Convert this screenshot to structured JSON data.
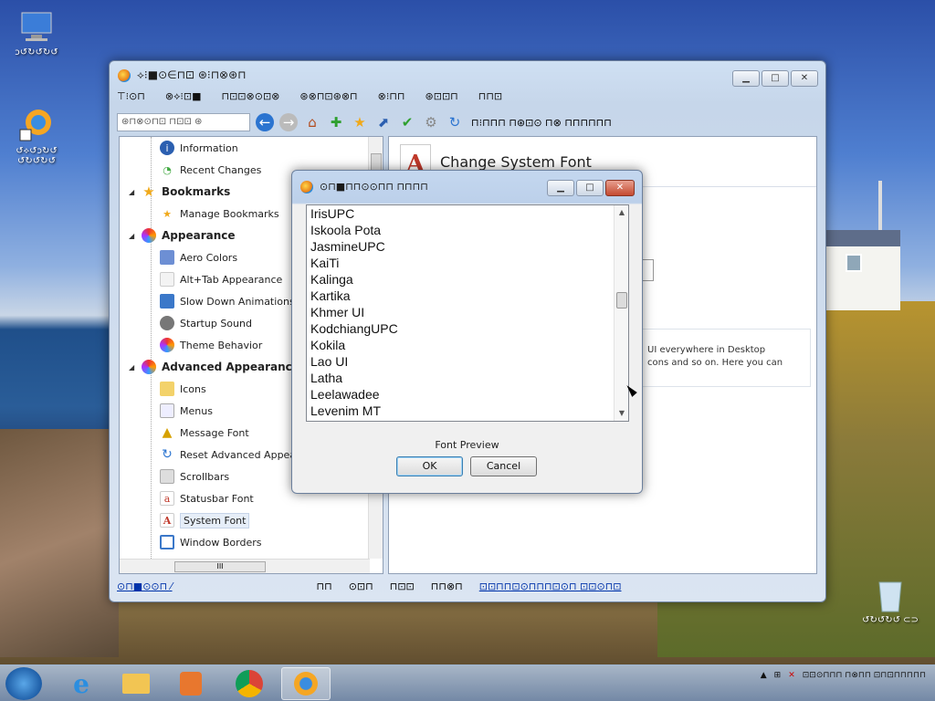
{
  "desktop": {
    "icons": [
      {
        "label": "ↄ↺↻↺↻↺"
      },
      {
        "label": "↺⟡↺ↄ↻↺ ↺↻↺↻↺"
      },
      {
        "label": "↺↻↺↻↺ ⊂⊃"
      }
    ]
  },
  "main_window": {
    "title": "⟡⁝■⊙∈⊓⊡ ⊛⁝⊓⊗⊛⊓",
    "menu": [
      "⊤⁝⊙⊓",
      "⊗⟡⁝⊡■",
      "⊓⊡⊡⊗⊙⊡⊗",
      "⊛⊗⊓⊡⊛⊗⊓",
      "⊗⁝⊓⊓",
      "⊛⊡⊡⊓",
      "⊓⊓⊡"
    ],
    "search_placeholder": "⊛⊓⊗⊙⊓⊡ ⊓⊡⊡ ⊛",
    "toolbar_label_1": "⊓⁝⊓⊓⊓ ⊓⊛⊡⊙ ⊓⊗ ⊓⊓⊓⊓⊓⊓",
    "tree": {
      "items": [
        {
          "label": "Information",
          "type": "item"
        },
        {
          "label": "Recent Changes",
          "type": "item"
        },
        {
          "label": "Bookmarks",
          "type": "group"
        },
        {
          "label": "Manage Bookmarks",
          "type": "item"
        },
        {
          "label": "Appearance",
          "type": "group"
        },
        {
          "label": "Aero Colors",
          "type": "item"
        },
        {
          "label": "Alt+Tab Appearance",
          "type": "item"
        },
        {
          "label": "Slow Down Animations",
          "type": "item"
        },
        {
          "label": "Startup Sound",
          "type": "item"
        },
        {
          "label": "Theme Behavior",
          "type": "item"
        },
        {
          "label": "Advanced Appearance S",
          "type": "group"
        },
        {
          "label": "Icons",
          "type": "item"
        },
        {
          "label": "Menus",
          "type": "item"
        },
        {
          "label": "Message Font",
          "type": "item"
        },
        {
          "label": "Reset Advanced Appeara",
          "type": "item"
        },
        {
          "label": "Scrollbars",
          "type": "item"
        },
        {
          "label": "Statusbar Font",
          "type": "item"
        },
        {
          "label": "System Font",
          "type": "item",
          "selected": true
        },
        {
          "label": "Window Borders",
          "type": "item"
        }
      ],
      "hscroll_label": "III"
    },
    "panel": {
      "title": "Change System Font",
      "desc_line1": "UI everywhere in Desktop",
      "desc_line2": "cons and so on. Here you can",
      "box_text": "⊓_"
    },
    "status": {
      "left_link": "⊙⊓■⊙⊙⊓ ⁄",
      "mid_1": "⊓⊓",
      "mid_2": "⊙⊡⊓",
      "mid_3": "⊓⊡⊡",
      "mid_4": "⊓⊓⊗⊓",
      "right_link": "⊡⊡⊓⊓⊡⊙⊓⊓⊓⊡⊙⊓ ⊡⊡⊙⊓⊡"
    }
  },
  "dialog": {
    "title": "⊙⊓■⊓⊓⊙⊙⊓⊓ ⊓⊓⊓⊓",
    "fonts": [
      "IrisUPC",
      "Iskoola Pota",
      "JasmineUPC",
      "KaiTi",
      "Kalinga",
      "Kartika",
      "Khmer UI",
      "KodchiangUPC",
      "Kokila",
      "Lao UI",
      "Latha",
      "Leelawadee",
      "Levenim MT"
    ],
    "preview_label": "Font Preview",
    "ok_label": "OK",
    "cancel_label": "Cancel"
  },
  "taskbar": {
    "tray_text": "⊡⊡⊙⊓⊓⊓ ⊓⊗⊓⊓ ⊡⊓⊡⊓⊓⊓⊓⊓"
  },
  "colors": {
    "selection": "#e6eef8",
    "link": "#0033aa",
    "close_red": "#c44a30"
  }
}
